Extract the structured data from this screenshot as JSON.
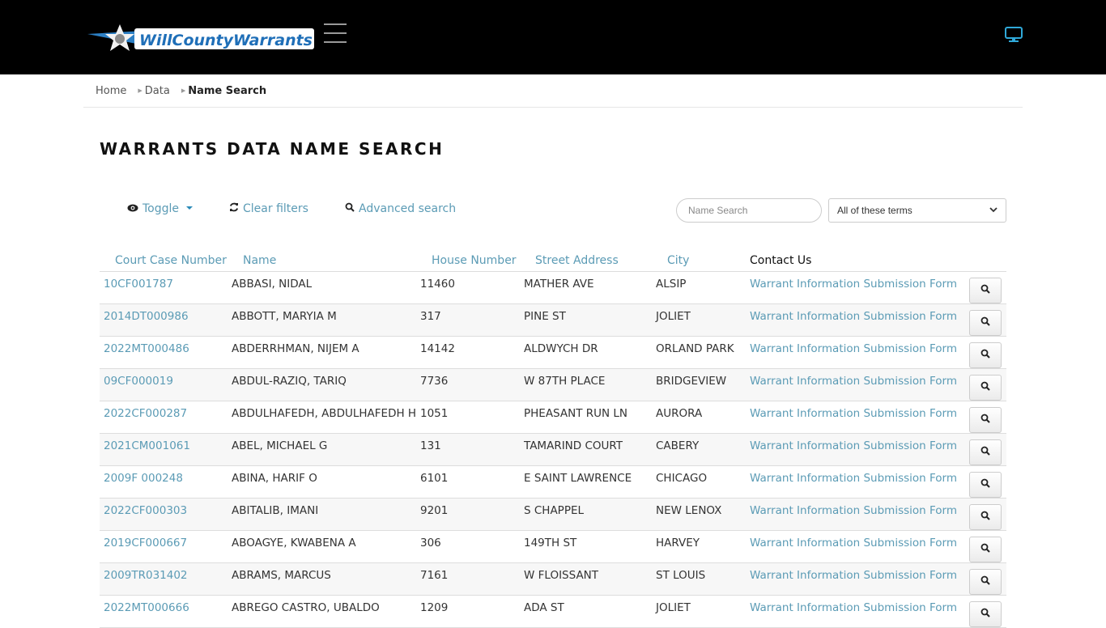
{
  "header": {
    "logo_text": "WillCountyWarrants",
    "menu_icon": "hamburger-icon",
    "device_icon": "monitor-icon",
    "accent_color": "#2fa8d8"
  },
  "breadcrumb": [
    {
      "label": "Home"
    },
    {
      "label": "Data"
    },
    {
      "label": "Name Search"
    }
  ],
  "page_title": "WARRANTS DATA NAME SEARCH",
  "toolbar": {
    "toggle_label": "Toggle",
    "clear_filters_label": "Clear filters",
    "advanced_search_label": "Advanced search",
    "name_search_placeholder": "Name Search",
    "match_select_value": "All of these terms"
  },
  "table": {
    "columns": [
      "Court Case Number",
      "Name",
      "House Number",
      "Street Address",
      "City",
      "Contact Us"
    ],
    "rows": [
      {
        "case": "10CF001787",
        "name": "ABBASI, NIDAL",
        "house": "11460",
        "street": "MATHER AVE",
        "city": "ALSIP",
        "contact": "Warrant Information Submission Form"
      },
      {
        "case": "2014DT000986",
        "name": "ABBOTT, MARYIA M",
        "house": "317",
        "street": "PINE ST",
        "city": "JOLIET",
        "contact": "Warrant Information Submission Form"
      },
      {
        "case": "2022MT000486",
        "name": "ABDERRHMAN, NIJEM A",
        "house": "14142",
        "street": "ALDWYCH DR",
        "city": "ORLAND PARK",
        "contact": "Warrant Information Submission Form"
      },
      {
        "case": "09CF000019",
        "name": "ABDUL-RAZIQ, TARIQ",
        "house": "7736",
        "street": "W 87TH PLACE",
        "city": "BRIDGEVIEW",
        "contact": "Warrant Information Submission Form"
      },
      {
        "case": "2022CF000287",
        "name": "ABDULHAFEDH, ABDULHAFEDH H",
        "house": "1051",
        "street": "PHEASANT RUN LN",
        "city": "AURORA",
        "contact": "Warrant Information Submission Form"
      },
      {
        "case": "2021CM001061",
        "name": "ABEL, MICHAEL G",
        "house": "131",
        "street": "TAMARIND COURT",
        "city": "CABERY",
        "contact": "Warrant Information Submission Form"
      },
      {
        "case": "2009F 000248",
        "name": "ABINA, HARIF O",
        "house": "6101",
        "street": "E SAINT LAWRENCE",
        "city": "CHICAGO",
        "contact": "Warrant Information Submission Form"
      },
      {
        "case": "2022CF000303",
        "name": "ABITALIB, IMANI",
        "house": "9201",
        "street": "S CHAPPEL",
        "city": "NEW LENOX",
        "contact": "Warrant Information Submission Form"
      },
      {
        "case": "2019CF000667",
        "name": "ABOAGYE, KWABENA A",
        "house": "306",
        "street": "149TH ST",
        "city": "HARVEY",
        "contact": "Warrant Information Submission Form"
      },
      {
        "case": "2009TR031402",
        "name": "ABRAMS, MARCUS",
        "house": "7161",
        "street": "W FLOISSANT",
        "city": "ST LOUIS",
        "contact": "Warrant Information Submission Form"
      },
      {
        "case": "2022MT000666",
        "name": "ABREGO CASTRO, UBALDO",
        "house": "1209",
        "street": "ADA ST",
        "city": "JOLIET",
        "contact": "Warrant Information Submission Form"
      }
    ]
  }
}
